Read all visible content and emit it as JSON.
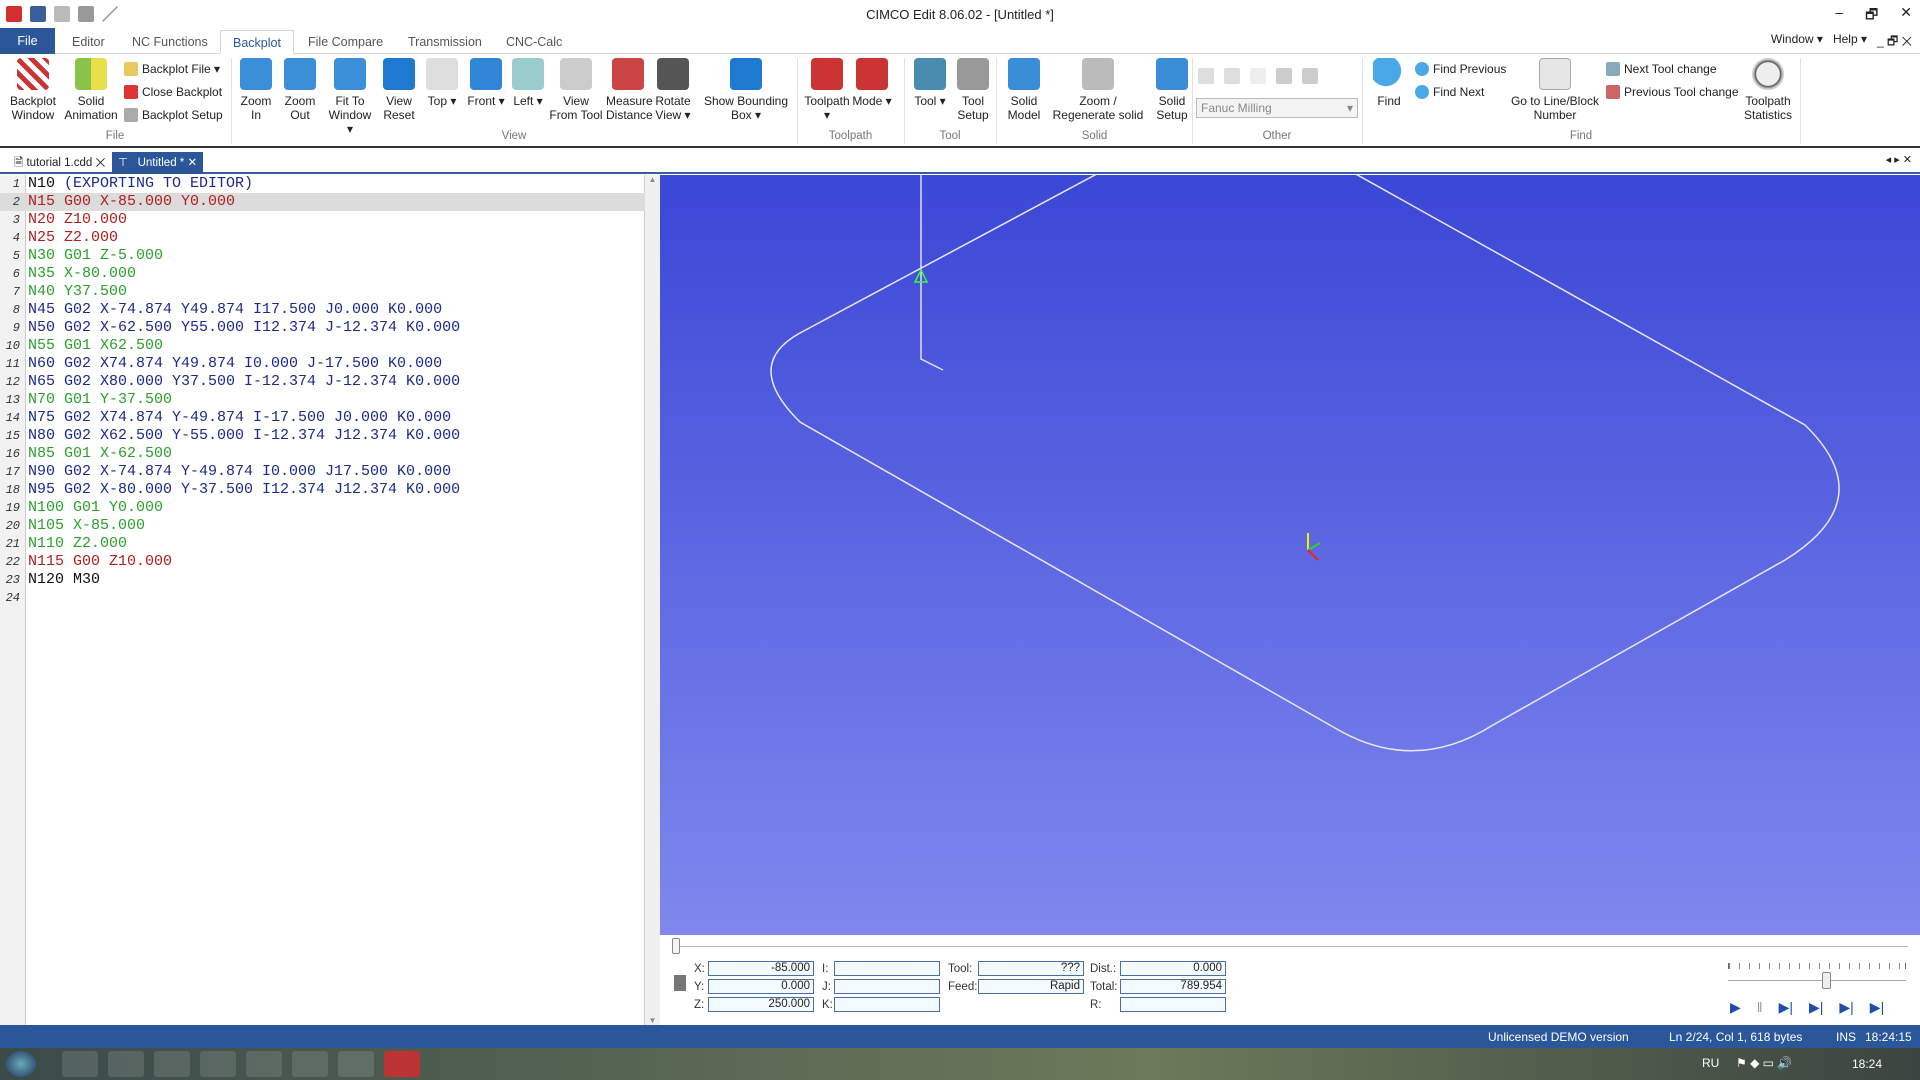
{
  "title": "CIMCO Edit 8.06.02 - [Untitled *]",
  "window_controls": [
    "–",
    "🗗",
    "✕"
  ],
  "ribbon_tabs": [
    "File",
    "Editor",
    "NC Functions",
    "Backplot",
    "File Compare",
    "Transmission",
    "CNC-Calc"
  ],
  "active_tab": "Backplot",
  "right_menu": {
    "window": "Window ▾",
    "help": "Help ▾"
  },
  "ribbon": {
    "file_group": {
      "label": "File",
      "backplot_window": "Backplot Window",
      "solid_animation": "Solid Animation",
      "backplot_file": "Backplot File ▾",
      "close_backplot": "Close Backplot",
      "backplot_setup": "Backplot Setup"
    },
    "view_group": {
      "label": "View",
      "buttons": [
        "Zoom In",
        "Zoom Out",
        "Fit To Window ▾",
        "View Reset",
        "Top ▾",
        "Front ▾",
        "Left ▾",
        "View From Tool",
        "Measure Distance",
        "Rotate View ▾",
        "Show Bounding Box ▾"
      ]
    },
    "toolpath_group": {
      "label": "Toolpath",
      "buttons": [
        "Toolpath ▾",
        "Mode ▾"
      ]
    },
    "tool_group": {
      "label": "Tool",
      "buttons": [
        "Tool ▾",
        "Tool Setup"
      ]
    },
    "solid_group": {
      "label": "Solid",
      "buttons": [
        "Solid Model",
        "Zoom / Regenerate solid",
        "Solid Setup"
      ]
    },
    "other_group": {
      "label": "Other",
      "machine": "Fanuc Milling"
    },
    "find_group": {
      "label": "Find",
      "find": "Find",
      "find_previous": "Find Previous",
      "find_next": "Find Next",
      "goto": "Go to Line/Block Number",
      "next_tool": "Next Tool change",
      "prev_tool": "Previous Tool change"
    },
    "stats": "Toolpath Statistics"
  },
  "doc_tabs": [
    {
      "label": "tutorial 1.cdd"
    },
    {
      "label": "Untitled *",
      "active": true
    }
  ],
  "colors": {
    "black": "#111111",
    "blue": "#1b2a8c",
    "red": "#b01e1e",
    "green": "#2ca02c",
    "accent": "#2b579a"
  },
  "code": {
    "current_line": 2,
    "lines": [
      {
        "n": "1",
        "parts": [
          {
            "t": "N10 ",
            "c": "black"
          },
          {
            "t": "(EXPORTING TO EDITOR)",
            "c": "blue"
          }
        ]
      },
      {
        "n": "2",
        "parts": [
          {
            "t": "N15 G00 X-85.000 Y0.000",
            "c": "red"
          }
        ]
      },
      {
        "n": "3",
        "parts": [
          {
            "t": "N20 Z10.000",
            "c": "red"
          }
        ]
      },
      {
        "n": "4",
        "parts": [
          {
            "t": "N25 Z2.000",
            "c": "red"
          }
        ]
      },
      {
        "n": "5",
        "parts": [
          {
            "t": "N30 G01 Z-5.000",
            "c": "green"
          }
        ]
      },
      {
        "n": "6",
        "parts": [
          {
            "t": "N35 X-80.000",
            "c": "green"
          }
        ]
      },
      {
        "n": "7",
        "parts": [
          {
            "t": "N40 Y37.500",
            "c": "green"
          }
        ]
      },
      {
        "n": "8",
        "parts": [
          {
            "t": "N45 G02 X-74.874 Y49.874 I17.500 J0.000 K0.000",
            "c": "blue"
          }
        ]
      },
      {
        "n": "9",
        "parts": [
          {
            "t": "N50 G02 X-62.500 Y55.000 I12.374 J-12.374 K0.000",
            "c": "blue"
          }
        ]
      },
      {
        "n": "10",
        "parts": [
          {
            "t": "N55 G01 X62.500",
            "c": "green"
          }
        ]
      },
      {
        "n": "11",
        "parts": [
          {
            "t": "N60 G02 X74.874 Y49.874 I0.000 J-17.500 K0.000",
            "c": "blue"
          }
        ]
      },
      {
        "n": "12",
        "parts": [
          {
            "t": "N65 G02 X80.000 Y37.500 I-12.374 J-12.374 K0.000",
            "c": "blue"
          }
        ]
      },
      {
        "n": "13",
        "parts": [
          {
            "t": "N70 G01 Y-37.500",
            "c": "green"
          }
        ]
      },
      {
        "n": "14",
        "parts": [
          {
            "t": "N75 G02 X74.874 Y-49.874 I-17.500 J0.000 K0.000",
            "c": "blue"
          }
        ]
      },
      {
        "n": "15",
        "parts": [
          {
            "t": "N80 G02 X62.500 Y-55.000 I-12.374 J12.374 K0.000",
            "c": "blue"
          }
        ]
      },
      {
        "n": "16",
        "parts": [
          {
            "t": "N85 G01 X-62.500",
            "c": "green"
          }
        ]
      },
      {
        "n": "17",
        "parts": [
          {
            "t": "N90 G02 X-74.874 Y-49.874 I0.000 J17.500 K0.000",
            "c": "blue"
          }
        ]
      },
      {
        "n": "18",
        "parts": [
          {
            "t": "N95 G02 X-80.000 Y-37.500 I12.374 J12.374 K0.000",
            "c": "blue"
          }
        ]
      },
      {
        "n": "19",
        "parts": [
          {
            "t": "N100 G01 Y0.000",
            "c": "green"
          }
        ]
      },
      {
        "n": "20",
        "parts": [
          {
            "t": "N105 X-85.000",
            "c": "green"
          }
        ]
      },
      {
        "n": "21",
        "parts": [
          {
            "t": "N110 Z2.000",
            "c": "green"
          }
        ]
      },
      {
        "n": "22",
        "parts": [
          {
            "t": "N115 G00 Z10.000",
            "c": "red"
          }
        ]
      },
      {
        "n": "23",
        "parts": [
          {
            "t": "N120 M30",
            "c": "black"
          }
        ]
      },
      {
        "n": "24",
        "parts": []
      }
    ]
  },
  "readout": {
    "x_label": "X:",
    "x": "-85.000",
    "y_label": "Y:",
    "y": "0.000",
    "z_label": "Z:",
    "z": "250.000",
    "i_label": "I:",
    "j_label": "J:",
    "k_label": "K:",
    "tool_label": "Tool:",
    "tool": "???",
    "feed_label": "Feed:",
    "feed": "Rapid",
    "dist_label": "Dist.:",
    "dist": "0.000",
    "total_label": "Total:",
    "total": "789.954",
    "r_label": "R:"
  },
  "playback": {
    "progress": 0,
    "speed": 0.55
  },
  "status": {
    "license": "Unlicensed DEMO version",
    "position": "Ln 2/24, Col 1, 618 bytes",
    "mode": "INS",
    "time": "18:24:15"
  },
  "taskbar": {
    "lang": "RU",
    "clock": "18:24"
  }
}
